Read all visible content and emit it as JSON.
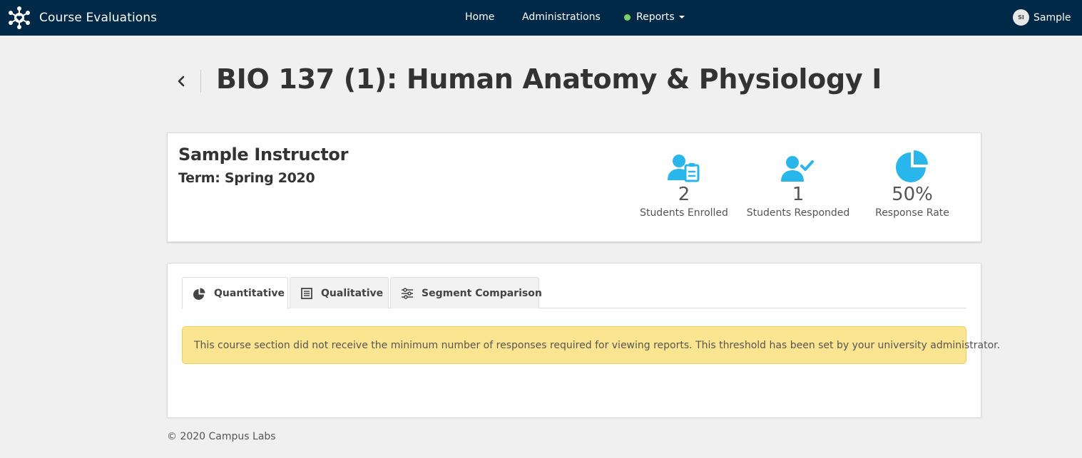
{
  "app": {
    "name": "Course Evaluations",
    "logo_icon": "network-hub-icon"
  },
  "nav": {
    "home": "Home",
    "administrations": "Administrations",
    "reports": "Reports",
    "reports_status_color": "#7ccf6a"
  },
  "user": {
    "initials": "SI",
    "name": "Sample"
  },
  "page": {
    "title": "BIO 137 (1): Human Anatomy & Physiology I",
    "back_icon": "chevron-left-icon"
  },
  "summary": {
    "instructor": "Sample Instructor",
    "term": "Term: Spring 2020",
    "stats": [
      {
        "icon": "user-clipboard-icon",
        "value": "2",
        "label": "Students Enrolled"
      },
      {
        "icon": "user-check-icon",
        "value": "1",
        "label": "Students Responded"
      },
      {
        "icon": "pie-chart-icon",
        "value": "50%",
        "label": "Response Rate"
      }
    ],
    "accent_color": "#29b6ea"
  },
  "tabs": [
    {
      "label": "Quantitative",
      "icon": "pie-chart-icon",
      "active": true
    },
    {
      "label": "Qualitative",
      "icon": "document-list-icon",
      "active": false
    },
    {
      "label": "Segment Comparison",
      "icon": "sliders-icon",
      "active": false
    }
  ],
  "alert": {
    "message": "This course section did not receive the minimum number of responses required for viewing reports. This threshold has been set by your university administrator."
  },
  "footer": {
    "copyright": "© 2020 Campus Labs"
  }
}
